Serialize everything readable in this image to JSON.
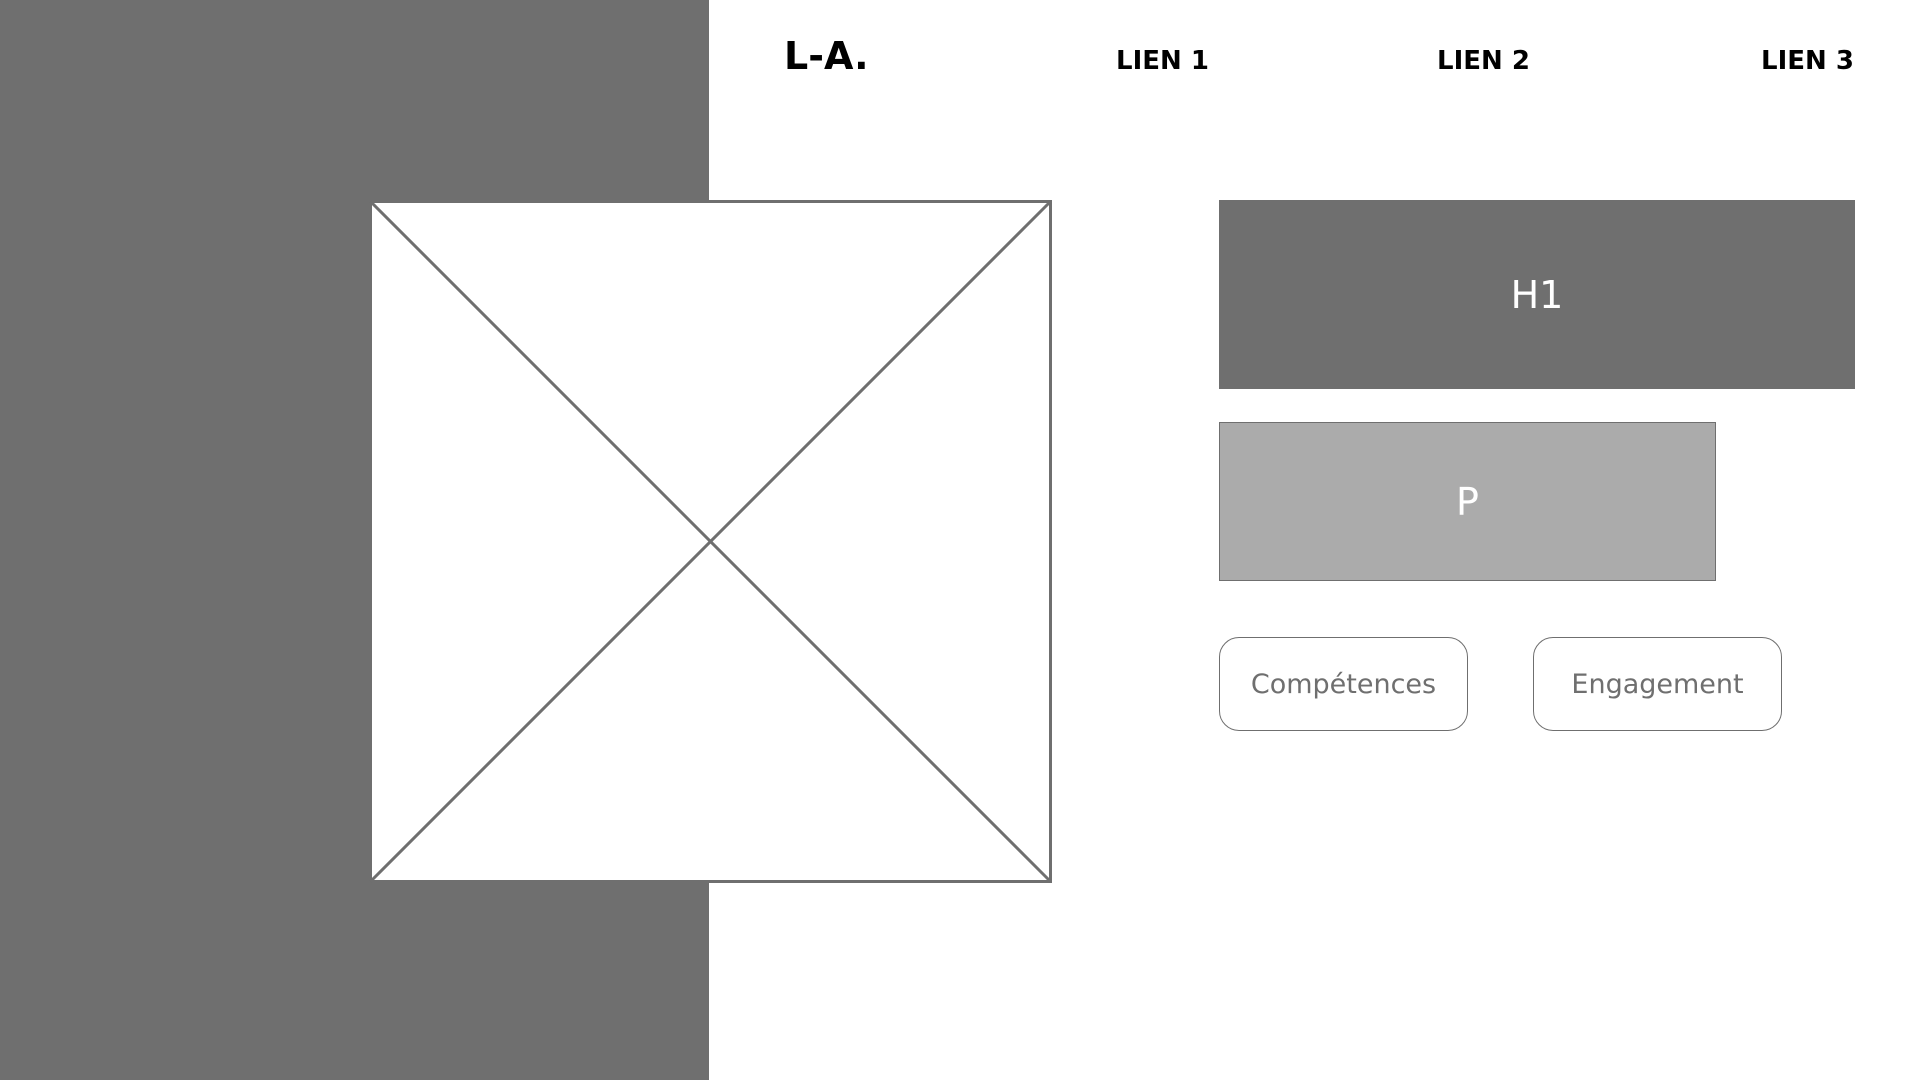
{
  "header": {
    "logo": "L-A.",
    "nav": [
      {
        "label": "LIEN 1"
      },
      {
        "label": "LIEN 2"
      },
      {
        "label": "LIEN 3"
      }
    ]
  },
  "hero": {
    "image_icon": "image-placeholder-icon",
    "heading": "H1",
    "paragraph": "P",
    "buttons": [
      {
        "label": "Compétences"
      },
      {
        "label": "Engagement"
      }
    ]
  },
  "colors": {
    "panel": "#6f6f6f",
    "paragraph_bg": "#ababab",
    "text_dark": "#000000",
    "text_light": "#ffffff",
    "button_text": "#6f6f6f",
    "background": "#ffffff"
  }
}
